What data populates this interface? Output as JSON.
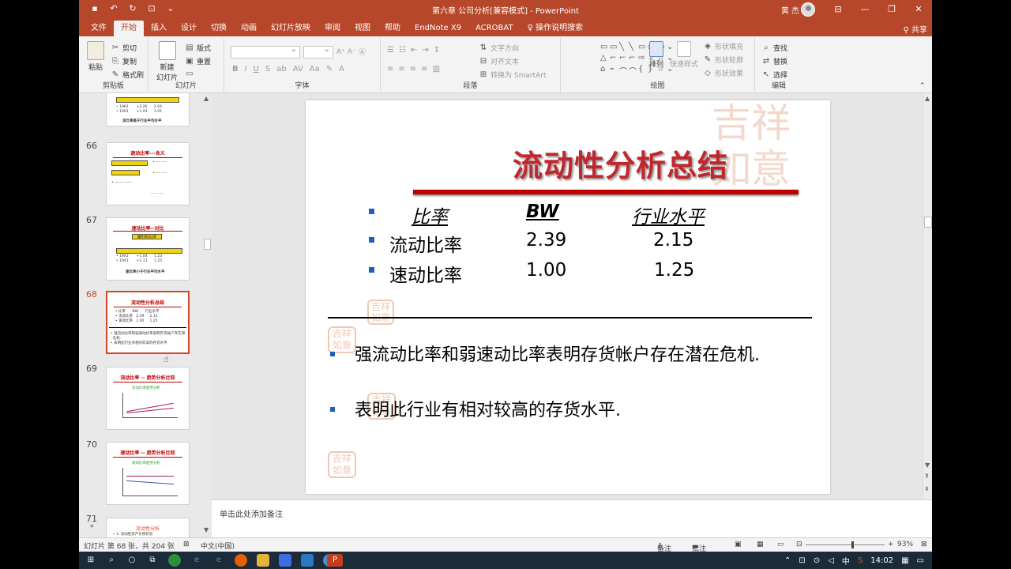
{
  "window": {
    "title": "第六章 公司分析[兼容模式] - PowerPoint",
    "user": "黄 杰",
    "share_label": "共享"
  },
  "tabs": [
    "文件",
    "开始",
    "插入",
    "设计",
    "切换",
    "动画",
    "幻灯片放映",
    "审阅",
    "视图",
    "帮助",
    "EndNote X9",
    "ACROBAT"
  ],
  "tell_me": "操作说明搜索",
  "ribbon": {
    "clipboard": {
      "label": "剪贴板",
      "paste": "粘贴",
      "cut": "剪切",
      "copy": "复制",
      "format_painter": "格式刷"
    },
    "slides": {
      "label": "幻灯片",
      "new_slide": "新建\n幻灯片",
      "layout": "版式",
      "reset": "重置"
    },
    "font": {
      "label": "字体"
    },
    "paragraph": {
      "label": "段落",
      "text_direction": "文字方向",
      "align_text": "对齐文本",
      "smartart": "转换为 SmartArt"
    },
    "drawing": {
      "label": "绘图",
      "arrange": "排列",
      "quick_styles": "快速样式",
      "shape_fill": "形状填充",
      "shape_outline": "形状轮廓",
      "shape_effects": "形状效果"
    },
    "editing": {
      "label": "编辑",
      "find": "查找",
      "replace": "替换",
      "select": "选择"
    }
  },
  "thumbnails": [
    {
      "num": "66",
      "title": "速动比率---含义"
    },
    {
      "num": "67",
      "title": "速动比率--对比",
      "box": "酸性测试比率",
      "caption": "速比率小于行业平均水平"
    },
    {
      "num": "68",
      "title": "流动性分析总结",
      "selected": true
    },
    {
      "num": "69",
      "title": "流动比率 -- 趋势分析比较",
      "subtitle": "流动比率趋势分析"
    },
    {
      "num": "70",
      "title": "速动比率 -- 趋势分析比较",
      "subtitle": "速动比率趋势分析"
    },
    {
      "num": "71",
      "title": "流动性分析"
    }
  ],
  "top_thumb_caption": "流比率高于行业平均水平",
  "slide": {
    "title": "流动性分析总结",
    "header": {
      "ratio": "比率",
      "bw": "BW",
      "industry": "行业水平"
    },
    "rows": [
      {
        "ratio": "流动比率",
        "bw": "2.39",
        "industry": "2.15"
      },
      {
        "ratio": "速动比率",
        "bw": "1.00",
        "industry": "1.25"
      }
    ],
    "bullets": [
      "强流动比率和弱速动比率表明存货帐户存在潜在危机.",
      "表明此行业有相对较高的存货水平."
    ]
  },
  "notes_placeholder": "单击此处添加备注",
  "status": {
    "slide_info": "幻灯片 第 68 张，共 204 张",
    "language": "中文(中国)",
    "notes_btn": "备注",
    "comments_btn": "批注",
    "zoom": "93%"
  },
  "taskbar": {
    "time": "14:02",
    "ime": "中"
  },
  "colors": {
    "accent": "#b7472a",
    "slide_title": "#c0272d",
    "bullet": "#1f5fbf"
  }
}
